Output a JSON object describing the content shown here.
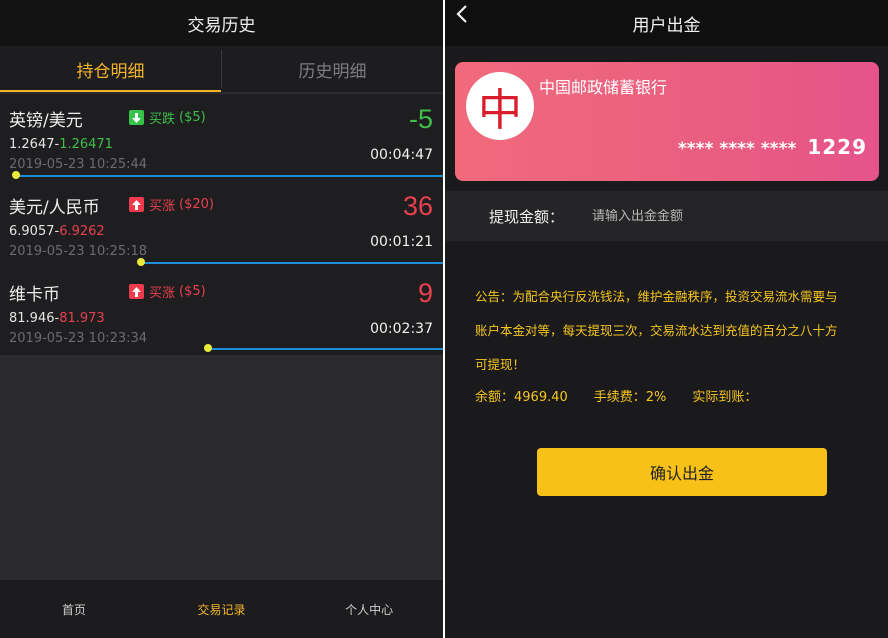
{
  "left": {
    "title": "交易历史",
    "tabs": [
      {
        "label": "持仓明细",
        "active": true
      },
      {
        "label": "历史明细",
        "active": false
      }
    ],
    "positions": [
      {
        "pair": "英镑/美元",
        "direction": "买跌",
        "amount": "($5)",
        "trend": "down",
        "open_price": "1.2647-",
        "current_price": "1.26471",
        "opened_at": "2019-05-23 10:25:44",
        "pnl": "-5",
        "remaining": "00:04:47",
        "progress": 0.02
      },
      {
        "pair": "美元/人民币",
        "direction": "买涨",
        "amount": "($20)",
        "trend": "up",
        "open_price": "6.9057-",
        "current_price": "6.9262",
        "opened_at": "2019-05-23 10:25:18",
        "pnl": "36",
        "remaining": "00:01:21",
        "progress": 0.31
      },
      {
        "pair": "维卡币",
        "direction": "买涨",
        "amount": "($5)",
        "trend": "up",
        "open_price": "81.946-",
        "current_price": "81.973",
        "opened_at": "2019-05-23 10:23:34",
        "pnl": "9",
        "remaining": "00:02:37",
        "progress": 0.46
      }
    ],
    "nav": [
      {
        "label": "首页",
        "active": false
      },
      {
        "label": "交易记录",
        "active": true
      },
      {
        "label": "个人中心",
        "active": false
      }
    ]
  },
  "right": {
    "title": "用户出金",
    "back_icon": "chevron-left-icon",
    "card": {
      "bank_name": "中国邮政储蓄银行",
      "logo_char": "中",
      "masked": "**** **** ****",
      "last4": "1229"
    },
    "withdraw": {
      "label": "提现金额：",
      "placeholder": "请输入出金金额"
    },
    "notice_lines": [
      "公告：为配合央行反洗钱法，维护金融秩序，投资交易流水需要与",
      "账户本金对等，每天提现三次，交易流水达到充值的百分之八十方",
      "可提现！"
    ],
    "balance": "余额：4969.40",
    "fee": "手续费：2%",
    "actual": "实际到账：",
    "confirm_label": "确认出金"
  },
  "colors": {
    "accent": "#f5b52b",
    "up": "#e9404f",
    "down": "#3fbf49",
    "track": "#1e8fd6",
    "card_gradient_start": "#f06a7c",
    "card_gradient_end": "#e5538a",
    "confirm_button": "#f7c118"
  }
}
